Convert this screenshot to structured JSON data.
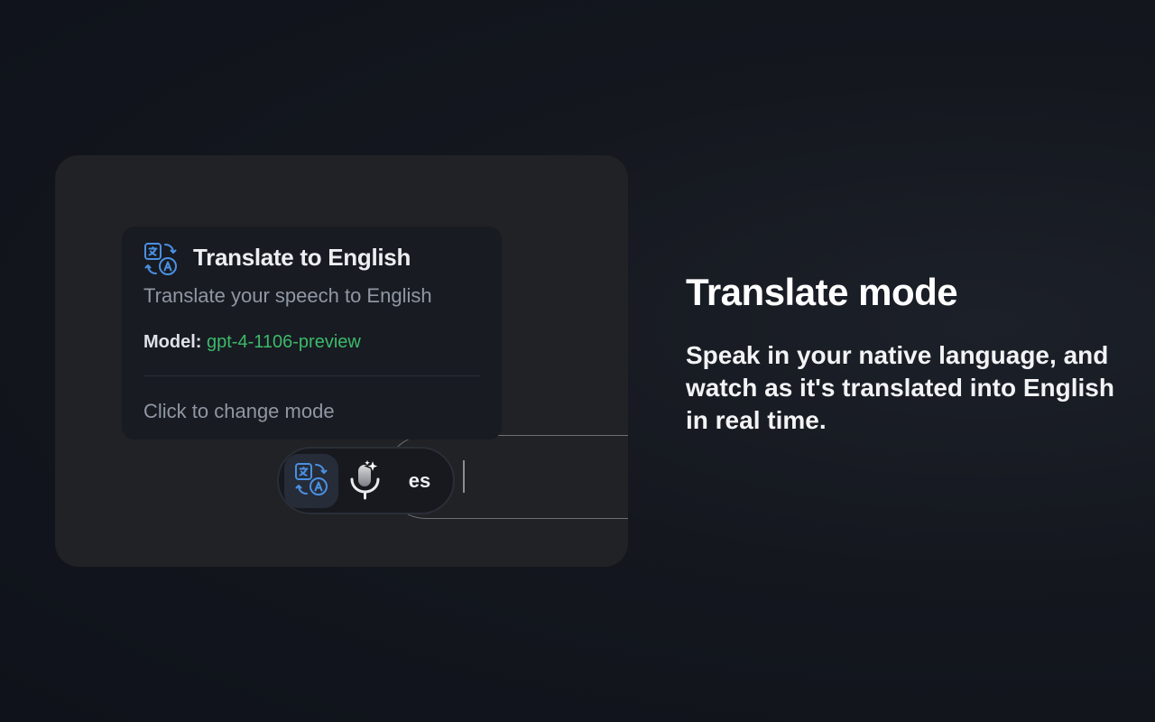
{
  "tooltip": {
    "title": "Translate to English",
    "description": "Translate your speech to English",
    "model_label": "Model:",
    "model_value": "gpt-4-1106-preview",
    "change_mode": "Click to change mode",
    "icon": "translate-icon"
  },
  "toolbar": {
    "translate_icon": "translate-icon",
    "mic_icon": "microphone-sparkle-icon",
    "language_code": "es"
  },
  "promo": {
    "heading": "Translate mode",
    "subheading": "Speak in your native language, and watch as it's translated into English in real time."
  },
  "colors": {
    "accent_blue": "#4a90e2",
    "model_green": "#3dba6a",
    "panel_bg": "#212225",
    "tooltip_bg": "#181b22"
  }
}
